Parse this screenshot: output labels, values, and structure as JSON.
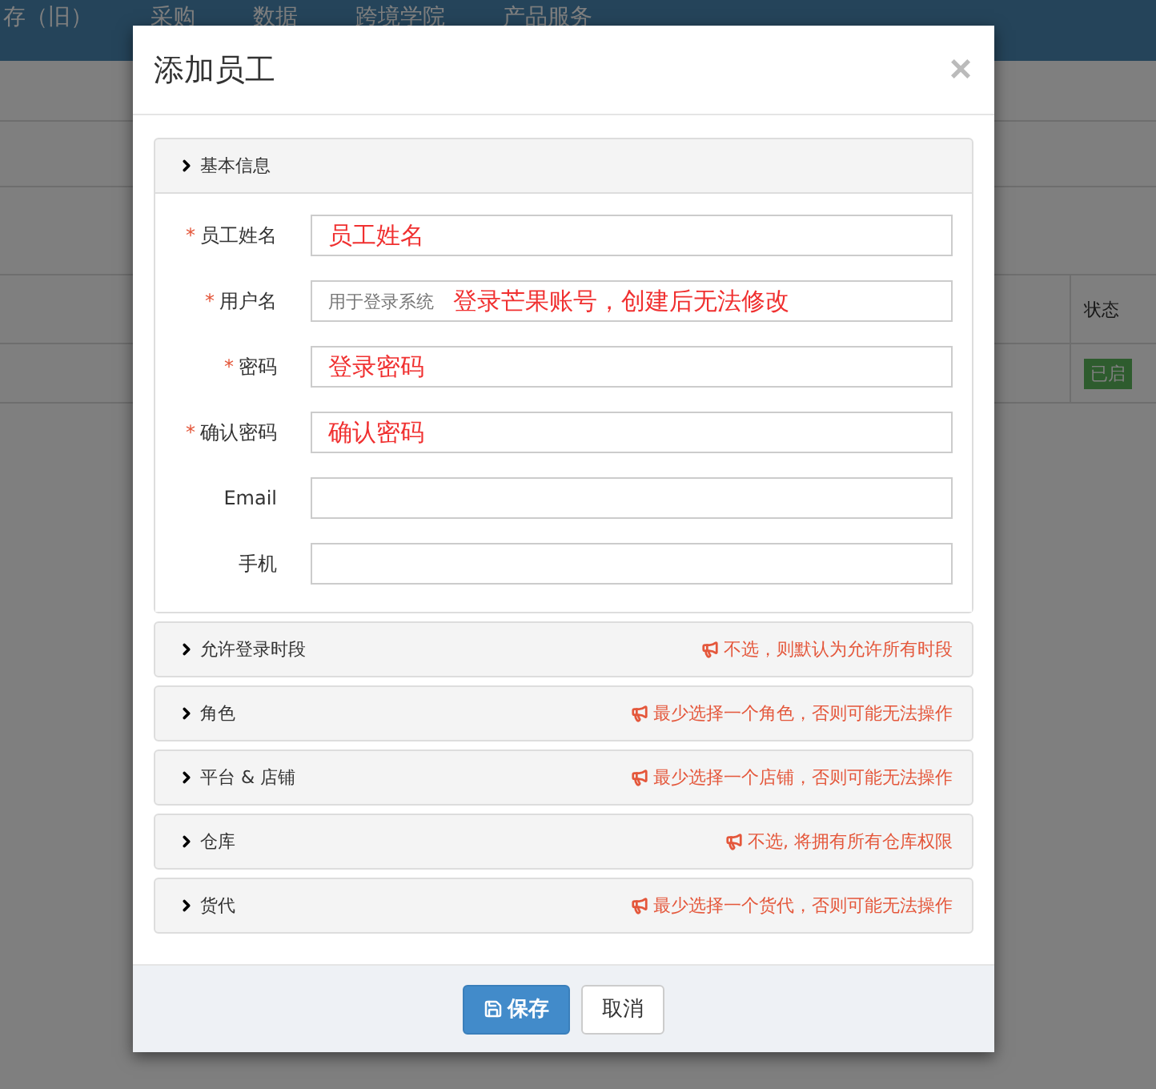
{
  "nav": {
    "items": [
      "存（旧）",
      "采购",
      "数据",
      "跨境学院",
      "产品服务"
    ]
  },
  "background_table": {
    "header": "状态",
    "status_badge": "已启"
  },
  "dialog": {
    "title": "添加员工",
    "close": "×",
    "basic_section": {
      "title": "基本信息",
      "expanded": true,
      "fields": [
        {
          "label": "员工姓名",
          "required_mark": "*",
          "annotation": "员工姓名"
        },
        {
          "label": "用户名",
          "required_mark": "*",
          "placeholder": "用于登录系统",
          "annotation": "登录芒果账号，创建后无法修改"
        },
        {
          "label": "密码",
          "required_mark": "*",
          "annotation": "登录密码"
        },
        {
          "label": "确认密码",
          "required_mark": "*",
          "annotation": "确认密码"
        },
        {
          "label": "Email"
        },
        {
          "label": "手机"
        }
      ]
    },
    "sections": [
      {
        "title": "允许登录时段",
        "expanded": false,
        "hint": "不选，则默认为允许所有时段"
      },
      {
        "title": "角色",
        "expanded": false,
        "hint": "最少选择一个角色，否则可能无法操作"
      },
      {
        "title": "平台 & 店铺",
        "expanded": false,
        "hint": "最少选择一个店铺，否则可能无法操作"
      },
      {
        "title": "仓库",
        "expanded": false,
        "hint": "不选, 将拥有所有仓库权限"
      },
      {
        "title": "货代",
        "expanded": false,
        "hint": "最少选择一个货代，否则可能无法操作"
      }
    ],
    "buttons": [
      {
        "kind": "primary",
        "label": "保存"
      },
      {
        "kind": "default",
        "label": "取消"
      }
    ]
  }
}
